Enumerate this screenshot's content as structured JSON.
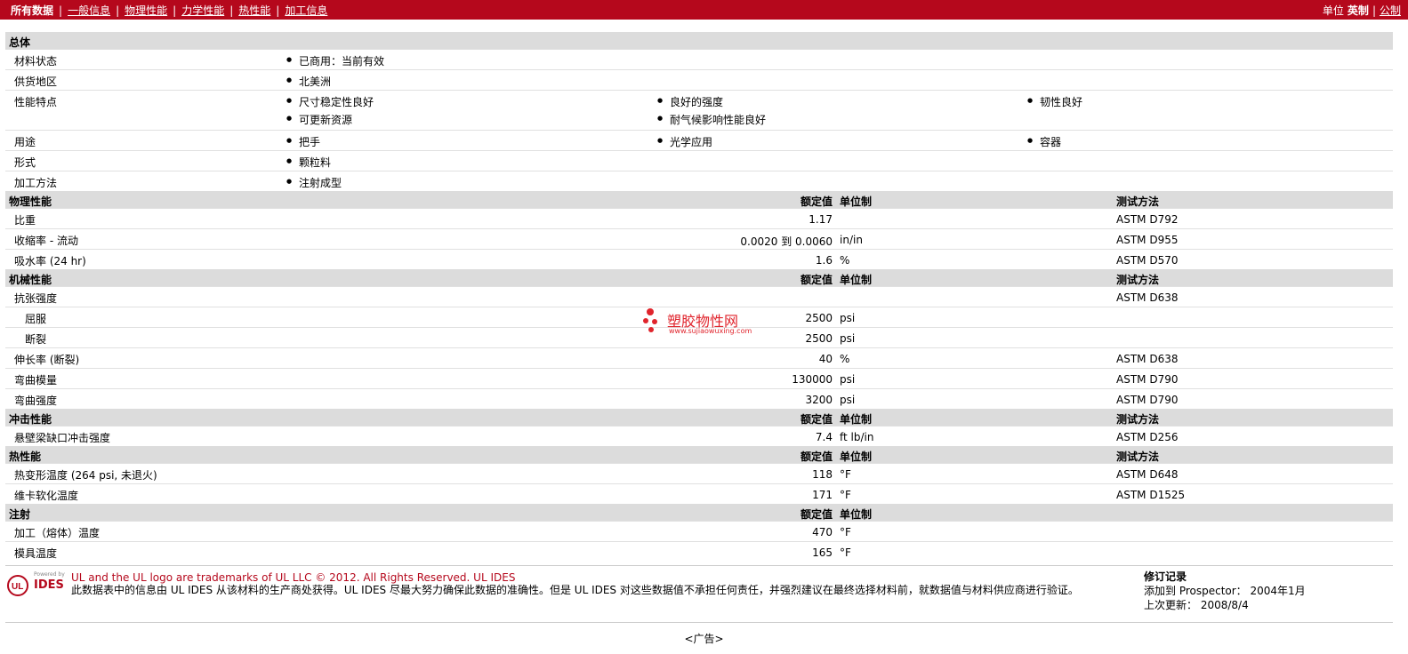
{
  "topbar": {
    "all_data": "所有数据",
    "tabs": [
      "一般信息",
      "物理性能",
      "力学性能",
      "热性能",
      "加工信息"
    ],
    "units_label": "单位",
    "unit_current": "英制",
    "unit_other": "公制"
  },
  "general": {
    "title": "总体",
    "rows": [
      {
        "label": "材料状态",
        "items": [
          "已商用：当前有效"
        ]
      },
      {
        "label": "供货地区",
        "items": [
          "北美洲"
        ]
      },
      {
        "label": "性能特点",
        "items": [
          "尺寸稳定性良好",
          "良好的强度",
          "韧性良好",
          "可更新资源",
          "耐气候影响性能良好"
        ]
      },
      {
        "label": "用途",
        "items": [
          "把手",
          "光学应用",
          "容器"
        ]
      },
      {
        "label": "形式",
        "items": [
          "颗粒料"
        ]
      },
      {
        "label": "加工方法",
        "items": [
          "注射成型"
        ]
      }
    ]
  },
  "headers": {
    "nominal": "额定值",
    "unit": "单位制",
    "method": "测试方法"
  },
  "physical": {
    "title": "物理性能",
    "rows": [
      {
        "label": "比重",
        "value": "1.17",
        "unit": "",
        "method": "ASTM D792"
      },
      {
        "label": "收缩率 - 流动",
        "value": "0.0020 到 0.0060",
        "unit": "in/in",
        "method": "ASTM D955"
      },
      {
        "label": "吸水率 (24 hr)",
        "value": "1.6",
        "unit": "%",
        "method": "ASTM D570"
      }
    ]
  },
  "mechanical": {
    "title": "机械性能",
    "rows": [
      {
        "label": "抗张强度",
        "value": "",
        "unit": "",
        "method": "ASTM D638"
      },
      {
        "label": "屈服",
        "value": "2500",
        "unit": "psi",
        "method": ""
      },
      {
        "label": "断裂",
        "value": "2500",
        "unit": "psi",
        "method": ""
      },
      {
        "label": "伸长率 (断裂)",
        "value": "40",
        "unit": "%",
        "method": "ASTM D638"
      },
      {
        "label": "弯曲模量",
        "value": "130000",
        "unit": "psi",
        "method": "ASTM D790"
      },
      {
        "label": "弯曲强度",
        "value": "3200",
        "unit": "psi",
        "method": "ASTM D790"
      }
    ]
  },
  "impact": {
    "title": "冲击性能",
    "rows": [
      {
        "label": "悬壁梁缺口冲击强度",
        "value": "7.4",
        "unit": "ft lb/in",
        "method": "ASTM D256"
      }
    ]
  },
  "thermal": {
    "title": "热性能",
    "rows": [
      {
        "label": "热变形温度 (264 psi, 未退火)",
        "value": "118",
        "unit": "°F",
        "method": "ASTM D648"
      },
      {
        "label": "维卡软化温度",
        "value": "171",
        "unit": "°F",
        "method": "ASTM D1525"
      }
    ]
  },
  "injection": {
    "title": "注射",
    "rows": [
      {
        "label": "加工（熔体）温度",
        "value": "470",
        "unit": "°F",
        "method": ""
      },
      {
        "label": "模具温度",
        "value": "165",
        "unit": "°F",
        "method": ""
      }
    ]
  },
  "footer": {
    "logo_powered": "Powered by",
    "logo_ides": "IDES",
    "trademark": "UL and the UL logo are trademarks of UL LLC © 2012. All Rights Reserved. UL IDES",
    "disclaimer": "此数据表中的信息由 UL IDES 从该材料的生产商处获得。UL IDES 尽最大努力确保此数据的准确性。但是 UL IDES 对这些数据值不承担任何责任，并强烈建议在最终选择材料前，就数据值与材料供应商进行验证。",
    "rev_title": "修订记录",
    "rev_added": "添加到 Prospector： 2004年1月",
    "rev_updated": "上次更新： 2008/8/4"
  },
  "ad": "<广告>",
  "watermark": {
    "name": "塑胶物性网",
    "url": "www.sujiaowuxing.com"
  },
  "colors": {
    "brand": "#b5081c",
    "section_bg": "#dcdcdc"
  }
}
